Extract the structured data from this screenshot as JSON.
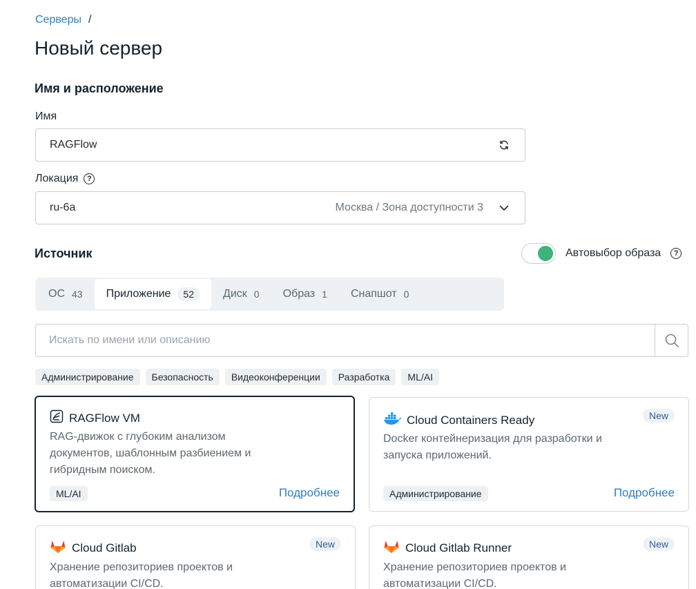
{
  "breadcrumb": {
    "parent": "Серверы",
    "separator": "/"
  },
  "page": {
    "title": "Новый сервер"
  },
  "sections": {
    "name_location": "Имя и расположение",
    "source": "Источник"
  },
  "name_field": {
    "label": "Имя",
    "value": "RAGFlow",
    "regenerate_icon": "refresh-icon"
  },
  "location_field": {
    "label": "Локация",
    "value": "ru-6a",
    "hint": "Москва / Зона доступности 3",
    "icon": "chevron-down-icon"
  },
  "auto_image": {
    "label": "Автовыбор образа",
    "enabled": true,
    "accent": "#3db27a"
  },
  "tabs": [
    {
      "label": "ОС",
      "count": "43",
      "active": false
    },
    {
      "label": "Приложение",
      "count": "52",
      "active": true
    },
    {
      "label": "Диск",
      "count": "0",
      "active": false
    },
    {
      "label": "Образ",
      "count": "1",
      "active": false
    },
    {
      "label": "Снапшот",
      "count": "0",
      "active": false
    }
  ],
  "search": {
    "placeholder": "Искать по имени или описанию",
    "icon": "search-icon"
  },
  "filters": [
    "Администрирование",
    "Безопасность",
    "Видеоконференции",
    "Разработка",
    "ML/AI"
  ],
  "cards": [
    {
      "title": "RAGFlow VM",
      "icon": "ragflow-icon",
      "badge": "",
      "description": "RAG-движок с глубоким анализом документов, шаблонным разбиением и гибридным поиском.",
      "tag": "ML/AI",
      "link": "Подробнее",
      "selected": true
    },
    {
      "title": "Cloud Containers Ready",
      "icon": "docker-icon",
      "badge": "New",
      "description": "Docker контейнеризация для разработки и запуска приложений.",
      "tag": "Администрирование",
      "link": "Подробнее",
      "selected": false
    },
    {
      "title": "Cloud Gitlab",
      "icon": "gitlab-icon",
      "badge": "New",
      "description": "Хранение репозиториев проектов и автоматизации CI/CD.",
      "tag": "",
      "link": "",
      "selected": false
    },
    {
      "title": "Cloud Gitlab Runner",
      "icon": "gitlab-icon",
      "badge": "New",
      "description": "Хранение репозиториев проектов и автоматизации CI/CD.",
      "tag": "",
      "link": "",
      "selected": false
    }
  ],
  "colors": {
    "link": "#2f7fc1",
    "text": "#13232f",
    "badge_text": "#2f5f93",
    "gitlab": "#e24329",
    "docker": "#2496ed"
  }
}
